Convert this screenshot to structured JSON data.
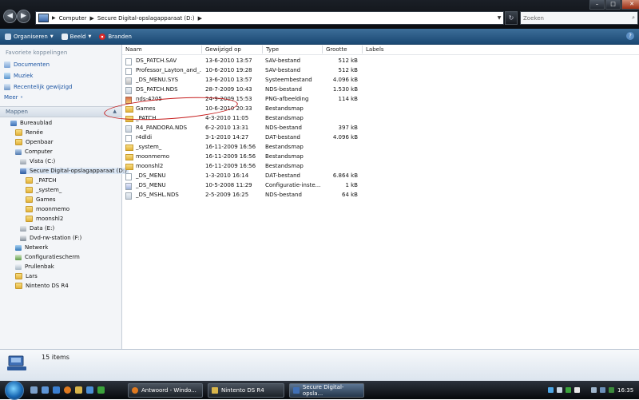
{
  "address": {
    "segments": [
      "Computer",
      "Secure Digital-opslagapparaat (D:)"
    ]
  },
  "search": {
    "placeholder": "Zoeken"
  },
  "toolbar": {
    "organize": "Organiseren",
    "view": "Beeld",
    "burn": "Branden"
  },
  "nav": {
    "favorites_header": "Favoriete koppelingen",
    "favorites": [
      {
        "label": "Documenten",
        "icon": "documents-icon"
      },
      {
        "label": "Muziek",
        "icon": "music-icon"
      },
      {
        "label": "Recentelijk gewijzigd",
        "icon": "recent-icon"
      }
    ],
    "more": "Meer",
    "folders_header": "Mappen",
    "tree": [
      {
        "label": "Bureaublad",
        "icon": "desktop-icon"
      },
      {
        "label": "Renée",
        "icon": "user-folder-icon"
      },
      {
        "label": "Openbaar",
        "icon": "public-folder-icon"
      },
      {
        "label": "Computer",
        "icon": "computer-icon"
      },
      {
        "label": "Vista (C:)",
        "icon": "drive-icon"
      },
      {
        "label": "Secure Digital-opslagapparaat (D:)",
        "icon": "sd-card-icon"
      },
      {
        "label": "_PATCH",
        "icon": "folder-icon"
      },
      {
        "label": "_system_",
        "icon": "folder-icon"
      },
      {
        "label": "Games",
        "icon": "folder-icon"
      },
      {
        "label": "moonmemo",
        "icon": "folder-icon"
      },
      {
        "label": "moonshl2",
        "icon": "folder-icon"
      },
      {
        "label": "Data (E:)",
        "icon": "drive-icon"
      },
      {
        "label": "Dvd-rw-station (F:)",
        "icon": "dvd-drive-icon"
      },
      {
        "label": "Netwerk",
        "icon": "network-icon"
      },
      {
        "label": "Configuratiescherm",
        "icon": "control-panel-icon"
      },
      {
        "label": "Prullenbak",
        "icon": "recycle-bin-icon"
      },
      {
        "label": "Lars",
        "icon": "folder-icon"
      },
      {
        "label": "Nintento DS R4",
        "icon": "folder-icon"
      }
    ]
  },
  "columns": [
    "Naam",
    "Gewijzigd op",
    "Type",
    "Grootte",
    "Labels"
  ],
  "files": [
    {
      "name": "DS_PATCH.SAV",
      "date": "13-6-2010 13:57",
      "type": "SAV-bestand",
      "size": "512 kB",
      "icon": "file-icon"
    },
    {
      "name": "Professor_Layton_and_...",
      "date": "10-6-2010 19:28",
      "type": "SAV-bestand",
      "size": "512 kB",
      "icon": "file-icon"
    },
    {
      "name": "_DS_MENU.SYS",
      "date": "13-6-2010 13:57",
      "type": "Systeembestand",
      "size": "4.096 kB",
      "icon": "system-file-icon"
    },
    {
      "name": "DS_PATCH.NDS",
      "date": "28-7-2009 10:43",
      "type": "NDS-bestand",
      "size": "1.530 kB",
      "icon": "nds-file-icon"
    },
    {
      "name": "nds-4205",
      "date": "24-9-2009 15:53",
      "type": "PNG-afbeelding",
      "size": "114 kB",
      "icon": "image-file-icon"
    },
    {
      "name": "Games",
      "date": "10-6-2010 20:33",
      "type": "Bestandsmap",
      "size": "",
      "icon": "folder-icon"
    },
    {
      "name": "_PATCH",
      "date": "4-3-2010 11:05",
      "type": "Bestandsmap",
      "size": "",
      "icon": "folder-icon"
    },
    {
      "name": "R4_PANDORA.NDS",
      "date": "6-2-2010 13:31",
      "type": "NDS-bestand",
      "size": "397 kB",
      "icon": "nds-file-icon"
    },
    {
      "name": "r4dldi",
      "date": "3-1-2010 14:27",
      "type": "DAT-bestand",
      "size": "4.096 kB",
      "icon": "file-icon"
    },
    {
      "name": "_system_",
      "date": "16-11-2009 16:56",
      "type": "Bestandsmap",
      "size": "",
      "icon": "folder-icon"
    },
    {
      "name": "moonmemo",
      "date": "16-11-2009 16:56",
      "type": "Bestandsmap",
      "size": "",
      "icon": "folder-icon"
    },
    {
      "name": "moonshl2",
      "date": "16-11-2009 16:56",
      "type": "Bestandsmap",
      "size": "",
      "icon": "folder-icon"
    },
    {
      "name": "_DS_MENU",
      "date": "1-3-2010 16:14",
      "type": "DAT-bestand",
      "size": "6.864 kB",
      "icon": "file-icon"
    },
    {
      "name": "_DS_MENU",
      "date": "10-5-2008 11:29",
      "type": "Configuratie-inste...",
      "size": "1 kB",
      "icon": "config-file-icon"
    },
    {
      "name": "_DS_MSHL.NDS",
      "date": "2-5-2009 16:25",
      "type": "NDS-bestand",
      "size": "64 kB",
      "icon": "nds-file-icon"
    }
  ],
  "details": {
    "count": "15 items"
  },
  "taskbar": {
    "tasks": [
      {
        "label": "Antwoord - Windo...",
        "icon": "firefox-icon"
      },
      {
        "label": "Nintento DS R4",
        "icon": "folder-icon"
      },
      {
        "label": "Secure Digital-opsla...",
        "icon": "sd-card-icon"
      }
    ],
    "clock": "16:35"
  }
}
